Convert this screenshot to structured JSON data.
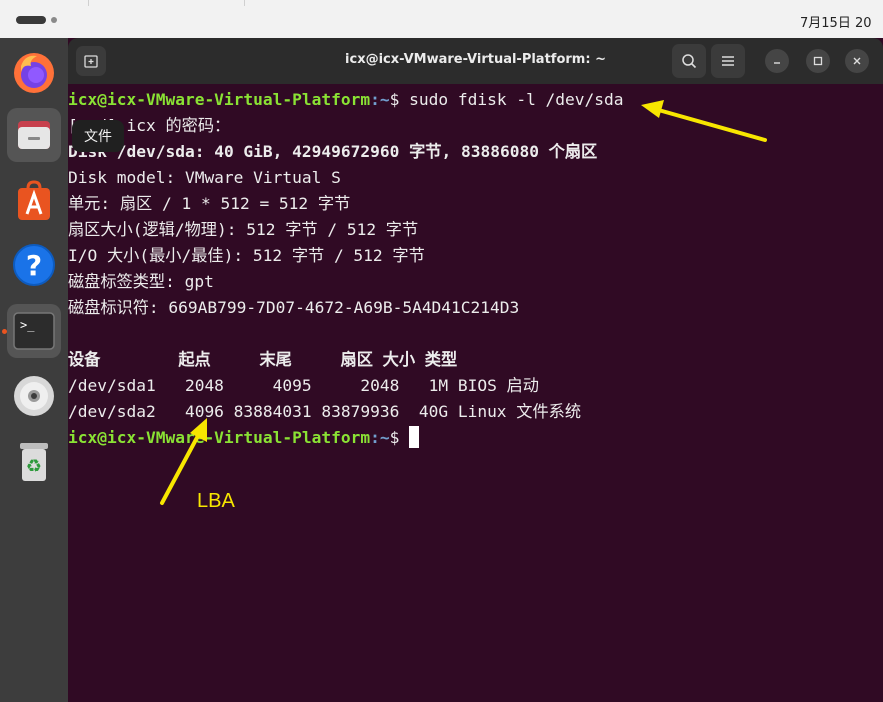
{
  "topbar": {
    "clock": "7月15日 20"
  },
  "dock": {
    "items": [
      {
        "name": "firefox"
      },
      {
        "name": "files"
      },
      {
        "name": "app-center"
      },
      {
        "name": "help"
      },
      {
        "name": "terminal"
      },
      {
        "name": "dvd"
      },
      {
        "name": "trash"
      }
    ],
    "tooltip": "文件"
  },
  "window": {
    "title": "icx@icx-VMware-Virtual-Platform: ~"
  },
  "terminal": {
    "prompt_user": "icx@icx-VMware-Virtual-Platform",
    "prompt_path": ":~",
    "cmd": "$ sudo fdisk -l /dev/sda",
    "pw_prefix": "[sud",
    "pw_line": "] icx 的密码：",
    "disk_summary_prefix": "Di",
    "disk_summary": "sk /dev/sda: 40 GiB, 42949672960 字节, 83886080 个扇区",
    "lines": [
      "Disk model: VMware Virtual S",
      "单元: 扇区 / 1 * 512 = 512 字节",
      "扇区大小(逻辑/物理): 512 字节 / 512 字节",
      "I/O 大小(最小/最佳): 512 字节 / 512 字节",
      "磁盘标签类型: gpt",
      "磁盘标识符: 669AB799-7D07-4672-A69B-5A4D41C214D3"
    ],
    "table_header": "设备        起点     末尾     扇区 大小 类型",
    "rows": [
      "/dev/sda1   2048     4095     2048   1M BIOS 启动",
      "/dev/sda2   4096 83884031 83879936  40G Linux 文件系统"
    ],
    "final_prompt_symbol": "$ "
  },
  "annotation": {
    "label": "LBA",
    "color": "#f7e600"
  }
}
